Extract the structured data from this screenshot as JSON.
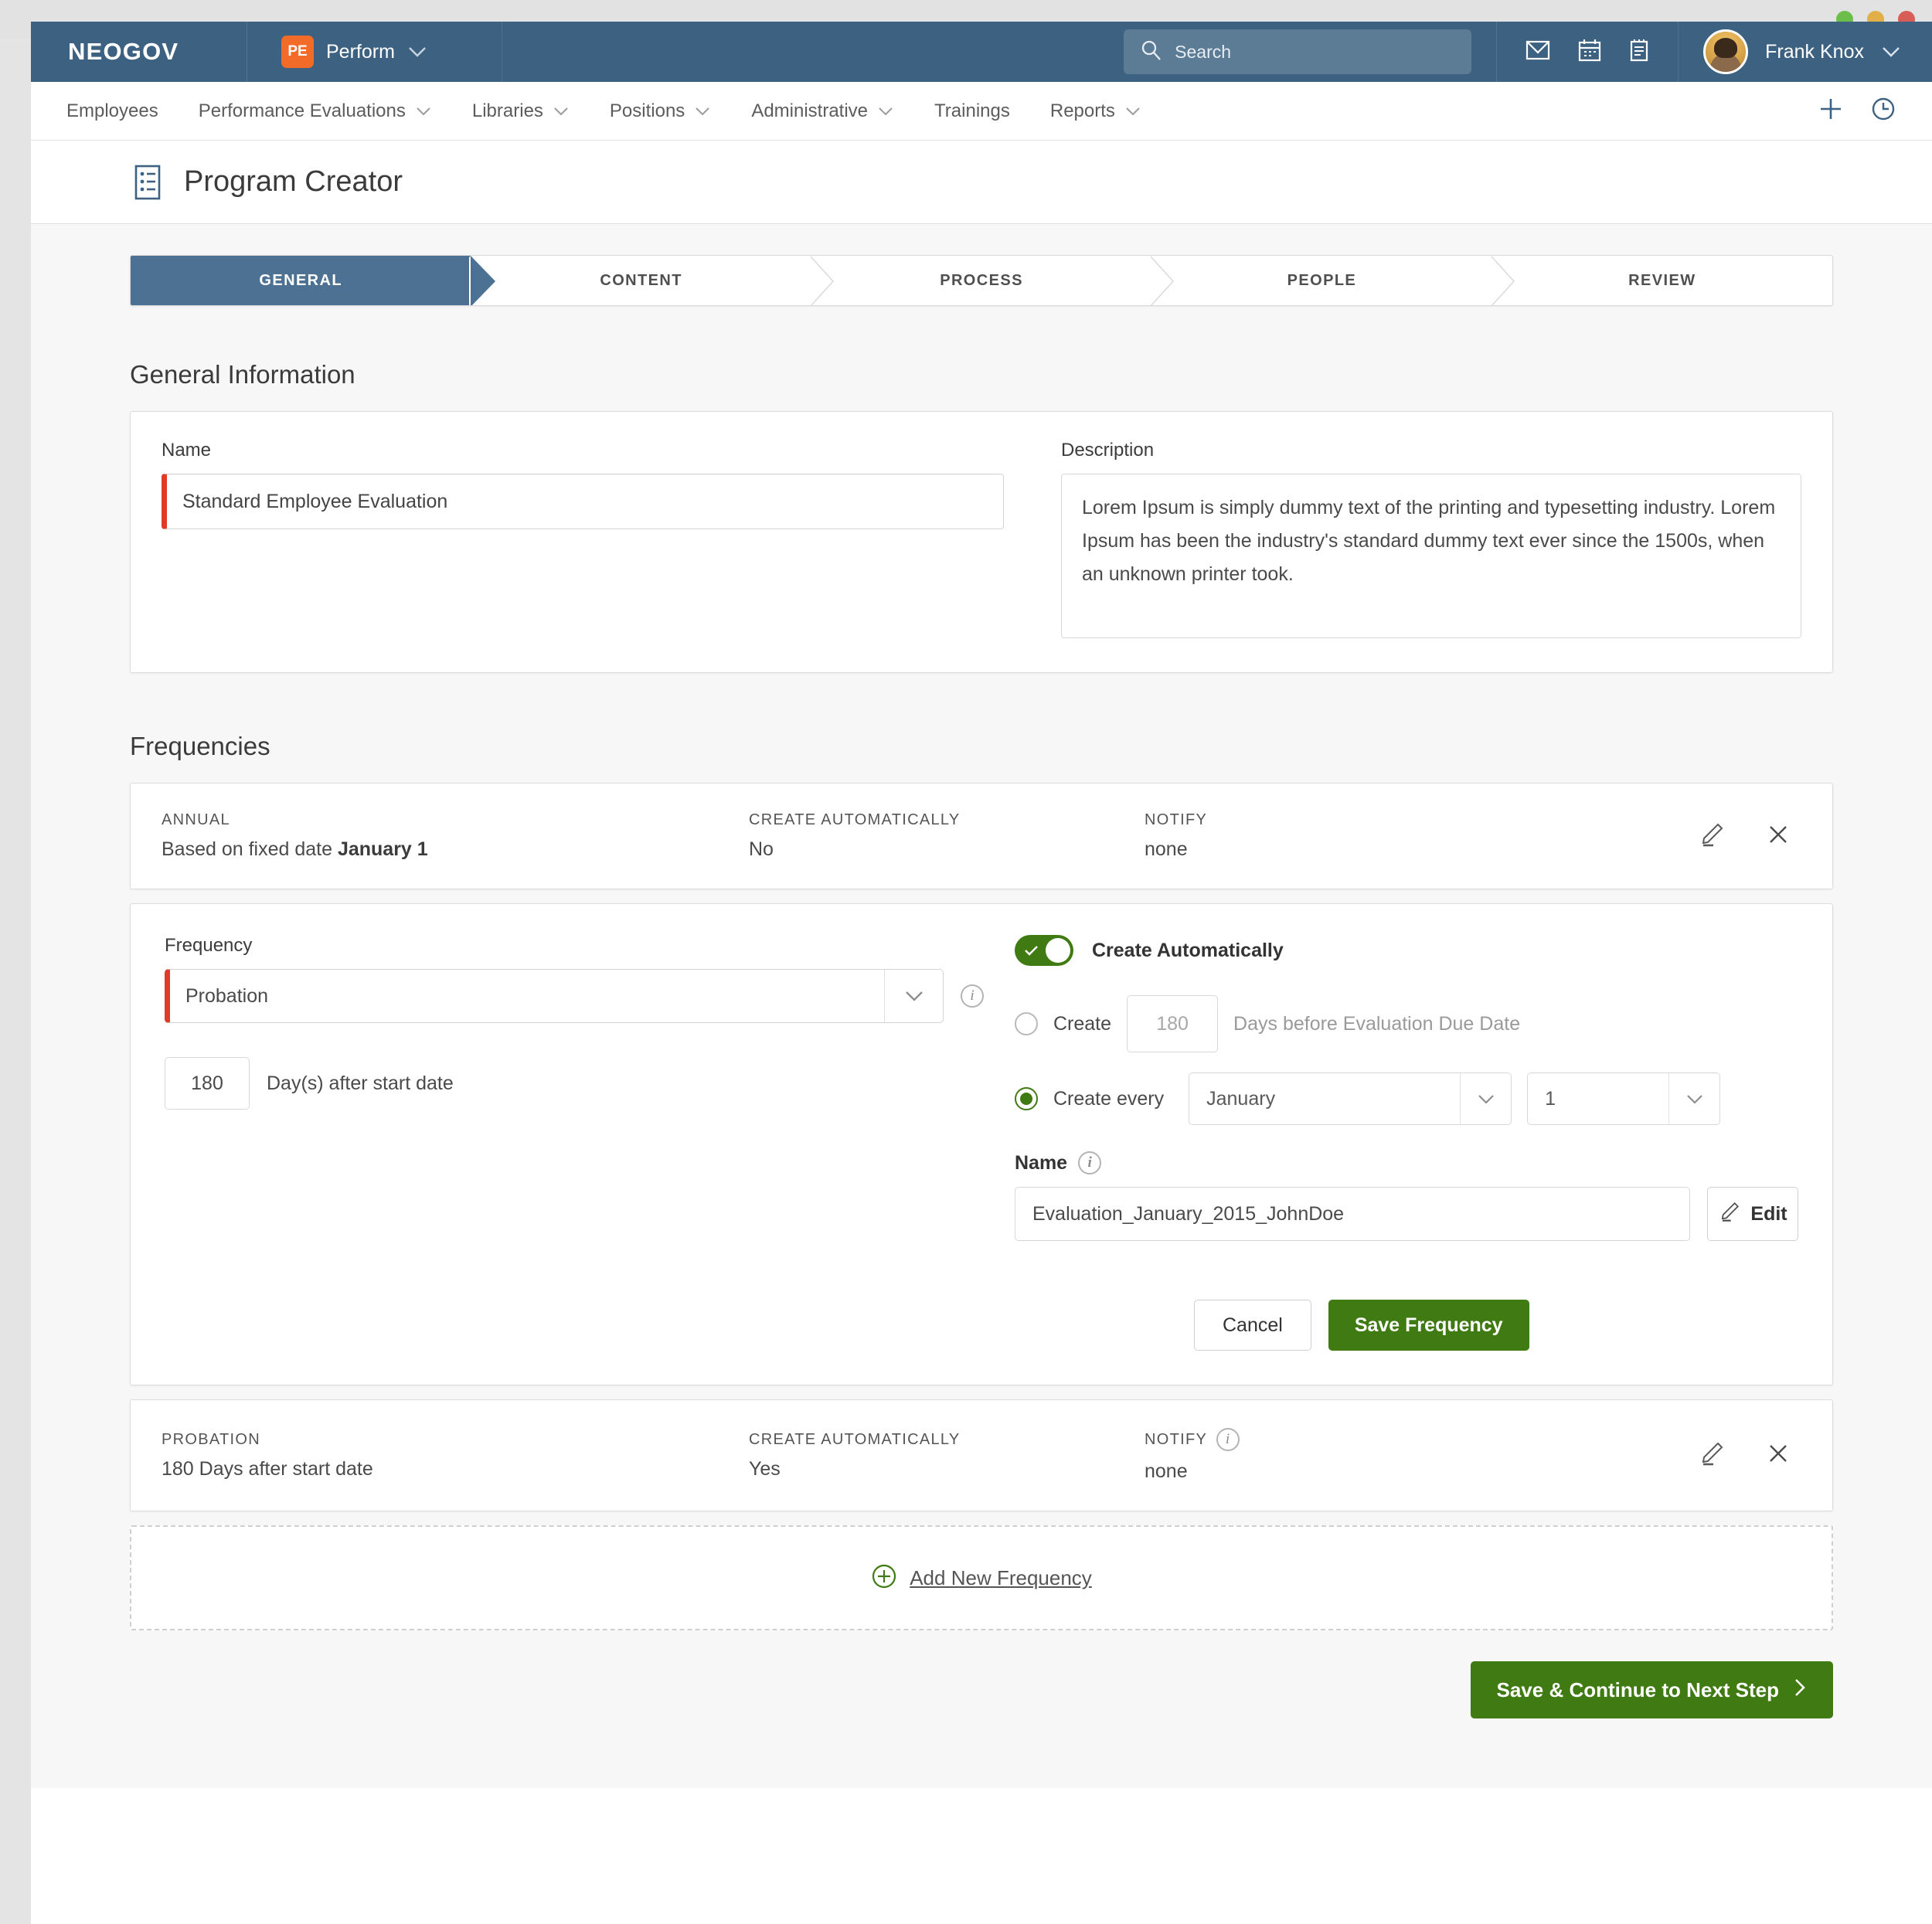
{
  "window": {
    "traffic_lights": [
      "#6cbe4a",
      "#e2ae48",
      "#d85d56"
    ]
  },
  "topbar": {
    "brand": "NEOGOV",
    "product_badge": "PE",
    "product_name": "Perform",
    "search_placeholder": "Search",
    "user_name": "Frank Knox",
    "icons": [
      "mail-icon",
      "calendar-icon",
      "notes-icon"
    ]
  },
  "nav": {
    "items": [
      {
        "label": "Employees",
        "has_caret": false
      },
      {
        "label": "Performance Evaluations",
        "has_caret": true
      },
      {
        "label": "Libraries",
        "has_caret": true
      },
      {
        "label": "Positions",
        "has_caret": true
      },
      {
        "label": "Administrative",
        "has_caret": true
      },
      {
        "label": "Trainings",
        "has_caret": false
      },
      {
        "label": "Reports",
        "has_caret": true
      }
    ],
    "right_icons": [
      "plus-icon",
      "history-clock-icon"
    ]
  },
  "page": {
    "title": "Program Creator",
    "icon": "document-list-icon"
  },
  "stepper": {
    "steps": [
      {
        "label": "GENERAL",
        "active": true
      },
      {
        "label": "CONTENT",
        "active": false
      },
      {
        "label": "PROCESS",
        "active": false
      },
      {
        "label": "PEOPLE",
        "active": false
      },
      {
        "label": "REVIEW",
        "active": false
      }
    ]
  },
  "general": {
    "heading": "General Information",
    "name_label": "Name",
    "name_value": "Standard Employee Evaluation",
    "description_label": "Description",
    "description_value": "Lorem Ipsum is simply dummy text of the printing and typesetting industry. Lorem Ipsum has been the industry's standard dummy text ever since the 1500s, when an unknown printer took."
  },
  "frequencies": {
    "heading": "Frequencies",
    "annual_row": {
      "title": "ANNUAL",
      "detail_prefix": "Based on fixed date",
      "detail_value": "January 1",
      "create_auto_label": "CREATE AUTOMATICALLY",
      "create_auto_value": "No",
      "notify_label": "NOTIFY",
      "notify_value": "none",
      "edit_icon": "pencil-icon",
      "delete_icon": "close-x-icon"
    },
    "editor": {
      "frequency_label": "Frequency",
      "frequency_value": "Probation",
      "days_value": "180",
      "days_label": "Day(s) after start date",
      "create_auto_toggle_label": "Create Automatically",
      "create_auto_toggle_on": true,
      "radio_create_label": "Create",
      "radio_create_days_placeholder": "180",
      "radio_create_suffix": "Days before Evaluation Due Date",
      "radio_create_selected": false,
      "radio_every_label": "Create every",
      "radio_every_selected": true,
      "month_value": "January",
      "count_value": "1",
      "name_label": "Name",
      "name_value": "Evaluation_January_2015_JohnDoe",
      "edit_button": "Edit",
      "cancel_button": "Cancel",
      "save_button": "Save Frequency"
    },
    "probation_row": {
      "title": "PROBATION",
      "detail_value": "180 Days after start date",
      "create_auto_label": "CREATE AUTOMATICALLY",
      "create_auto_value": "Yes",
      "notify_label": "NOTIFY",
      "notify_value": "none",
      "edit_icon": "pencil-icon",
      "delete_icon": "close-x-icon"
    },
    "add_new_label": "Add New Frequency"
  },
  "footer": {
    "continue_label": "Save & Continue to Next Step"
  },
  "colors": {
    "header_blue": "#3d6281",
    "step_active_blue": "#4c7192",
    "accent_green": "#3f7a12",
    "required_red": "#e03a28",
    "badge_orange": "#f26b29"
  }
}
